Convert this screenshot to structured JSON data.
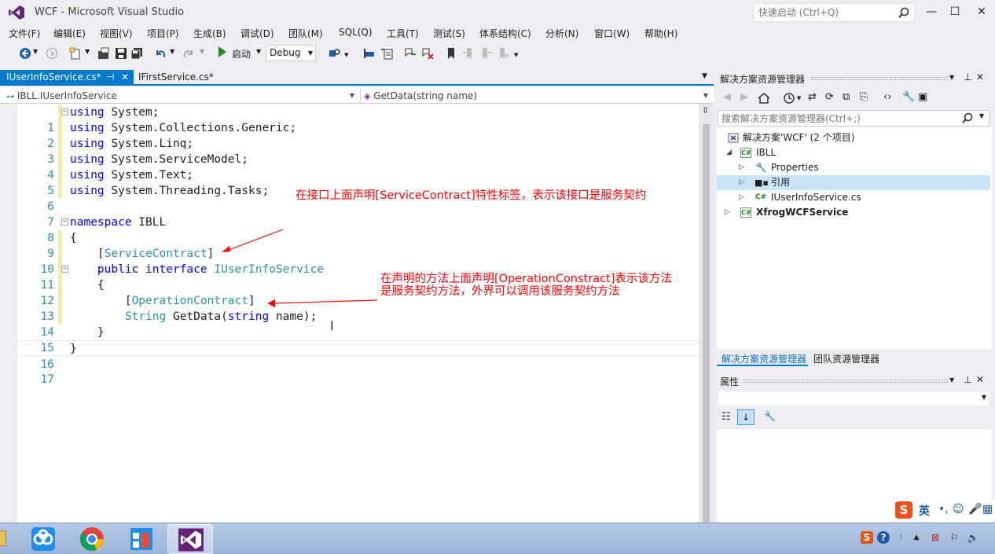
{
  "window": {
    "title": "WCF - Microsoft Visual Studio",
    "quick_launch_placeholder": "快速启动 (Ctrl+Q)",
    "min": "—",
    "max": "☐",
    "close": "✕"
  },
  "menu": [
    "文件(F)",
    "编辑(E)",
    "视图(V)",
    "项目(P)",
    "生成(B)",
    "调试(D)",
    "团队(M)",
    "SQL(Q)",
    "工具(T)",
    "测试(S)",
    "体系结构(C)",
    "分析(N)",
    "窗口(W)",
    "帮助(H)"
  ],
  "toolbar": {
    "start_label": "启动",
    "config": "Debug"
  },
  "tabs": {
    "active": "IUserInfoService.cs*",
    "second": "IFirstService.cs*",
    "pin": "⊣",
    "close": "✕"
  },
  "navbar": {
    "type_selector": "IBLL.IUserInfoService",
    "member_selector": "GetData(string name)"
  },
  "code_lines": [
    "1",
    "2",
    "3",
    "4",
    "5",
    "6",
    "7",
    "8",
    "9",
    "10",
    "11",
    "12",
    "13",
    "14",
    "15",
    "16",
    "17"
  ],
  "code": {
    "l1": [
      "using",
      " System;"
    ],
    "l2": [
      "using",
      " System.Collections.Generic;"
    ],
    "l3": [
      "using",
      " System.Linq;"
    ],
    "l4": [
      "using",
      " System.ServiceModel;"
    ],
    "l5": [
      "using",
      " System.Text;"
    ],
    "l6": [
      "using",
      " System.Threading.Tasks;"
    ],
    "l8": [
      "namespace",
      " IBLL"
    ],
    "l9": "{",
    "l10": [
      "    [",
      "ServiceContract",
      "]"
    ],
    "l11": [
      "    ",
      "public",
      " ",
      "interface",
      " ",
      "IUserInfoService"
    ],
    "l12": "    {",
    "l13": [
      "        [",
      "OperationContract",
      "]"
    ],
    "l14": [
      "        ",
      "String",
      " GetData(",
      "string",
      " name);"
    ],
    "l15": "    }",
    "l16": "}"
  },
  "annotations": {
    "a1": "在接口上面声明[ServiceContract]特性标签，表示该接口是服务契约",
    "a2_line1": "在声明的方法上面声明[OperationConstract]表示该方法",
    "a2_line2": "是服务契约方法，外界可以调用该服务契约方法"
  },
  "solution_explorer": {
    "title": "解决方案资源管理器",
    "search_placeholder": "搜索解决方案资源管理器(Ctrl+;)",
    "tree": [
      {
        "label": "解决方案'WCF' (2 个项目)"
      },
      {
        "label": "IBLL"
      },
      {
        "label": "Properties"
      },
      {
        "label": "引用"
      },
      {
        "label": "IUserInfoService.cs"
      },
      {
        "label": "XfrogWCFService"
      }
    ],
    "bottom_tab_1": "解决方案资源管理器",
    "bottom_tab_2": "团队资源管理器"
  },
  "properties": {
    "title": "属性"
  },
  "ime": {
    "logo": "S",
    "mode": "英"
  },
  "colors": {
    "accent": "#007acc",
    "keyword": "#0000ff",
    "type": "#2b91af",
    "annotation": "#ff0000"
  }
}
